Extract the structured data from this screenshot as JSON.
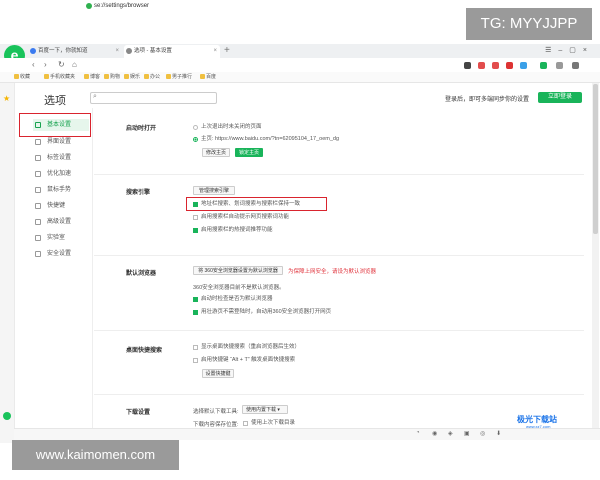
{
  "watermark_top": "TG: MYYJJPP",
  "watermark_bottom": "www.kaimomen.com",
  "tabs": [
    {
      "label": "百度一下，你就知道"
    },
    {
      "label": "选项 - 基本设置"
    }
  ],
  "address": {
    "url": "se://settings/browser"
  },
  "bookmarks": [
    "收藏",
    "手机收藏夹",
    "博客",
    "购物",
    "娱乐",
    "办公",
    "男子推行",
    "百度"
  ],
  "header": {
    "title": "选项",
    "login_prompt": "登录后，即可多端同步你的设置",
    "login_button": "立即登录"
  },
  "nav": [
    {
      "label": "基本设置"
    },
    {
      "label": "界面设置"
    },
    {
      "label": "标签设置"
    },
    {
      "label": "优化加速"
    },
    {
      "label": "鼠标手势"
    },
    {
      "label": "快捷键"
    },
    {
      "label": "高级设置"
    },
    {
      "label": "实验室"
    },
    {
      "label": "安全设置"
    }
  ],
  "startup": {
    "title": "启动时打开",
    "opt1": "上次退出时未关闭的页面",
    "opt2": "主页: https://www.baidu.com/?tn=62095104_17_oem_dg",
    "btn_edit": "修改主页",
    "btn_lock": "锁定主页"
  },
  "search": {
    "title": "搜索引擎",
    "btn_manage": "管理搜索引擎",
    "opt1": "地址栏搜索、划词搜索与搜索栏保持一致",
    "opt2": "启用搜索栏自动提示网页搜索词功能",
    "opt3": "启用搜索栏的热搜词推荐功能"
  },
  "default_browser": {
    "title": "默认浏览器",
    "btn_set": "将 360安全浏览器设置为默认浏览器",
    "warning": "为保障上网安全，请设为默认浏览器",
    "status": "360安全浏览器目前不是默认浏览器。",
    "opt1": "启动时检查是否为默认浏览器",
    "opt2": "用壮游页不需登陆时，自动用360安全浏览器打开网页"
  },
  "desktop_search": {
    "title": "桌面快捷搜索",
    "opt1": "显示桌面快捷搜索（重启浏览器后生效）",
    "opt2": "启用快捷键 “Alt + T” 触发桌面快捷搜索",
    "btn_shortcut": "设置快捷键"
  },
  "download": {
    "title": "下载设置",
    "tool_label": "选择默认下载工具:",
    "tool_value": "使用内置下载",
    "save_label": "下载内容保存位置:",
    "save_opt": "使用上次下载目录"
  },
  "brand": {
    "name": "极光下载站",
    "sub": "www.xz7.com"
  },
  "colors": {
    "accent": "#19b45a",
    "warning": "#e0323b",
    "highlight_box": "#d9242e"
  }
}
